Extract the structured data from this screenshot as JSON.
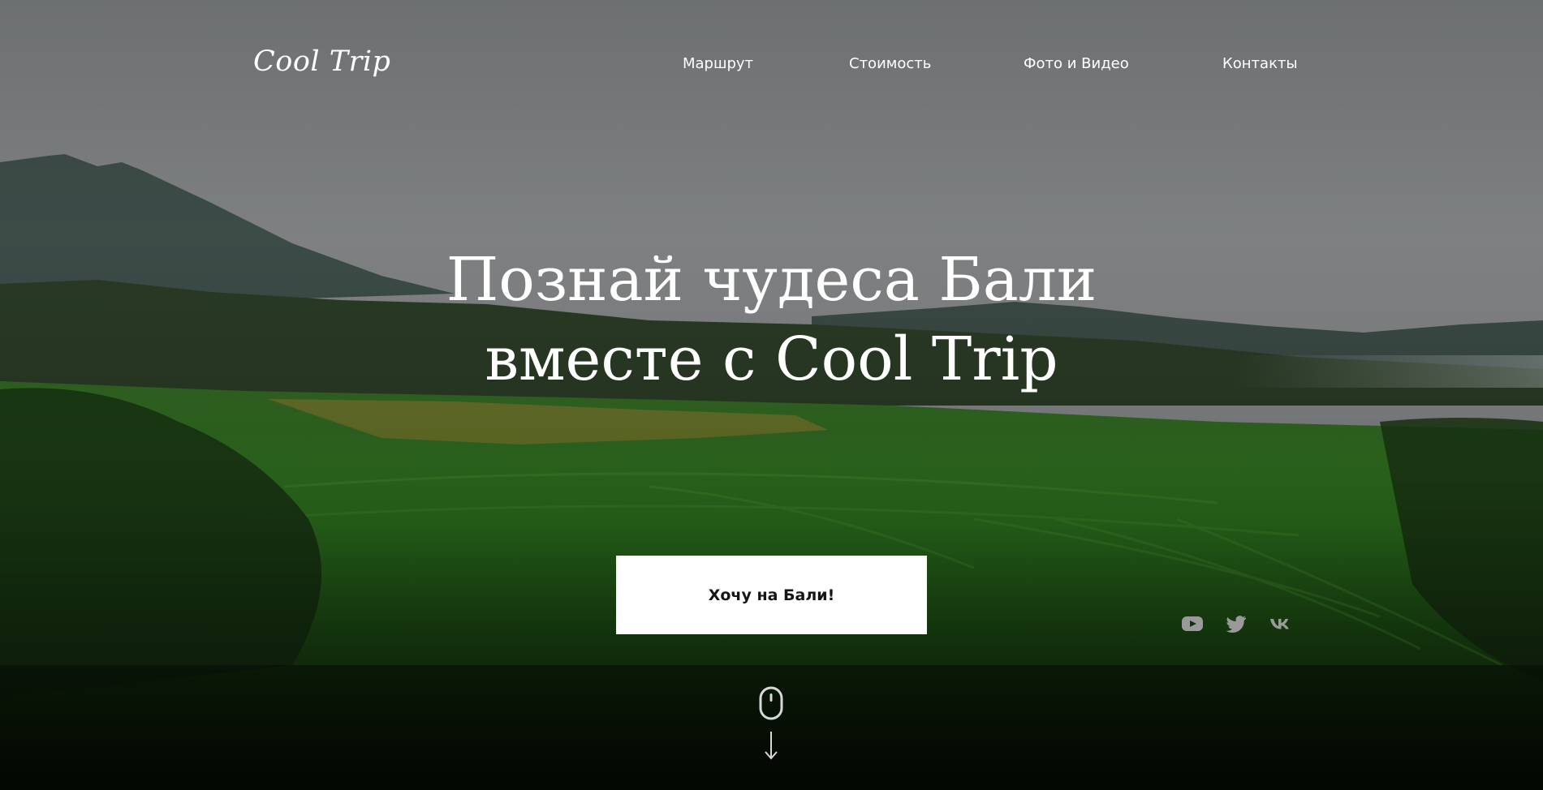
{
  "header": {
    "logo_text": "Cool Trip"
  },
  "nav": {
    "items": [
      {
        "label": "Маршрут"
      },
      {
        "label": "Стоимость"
      },
      {
        "label": "Фото и Видео"
      },
      {
        "label": "Контакты"
      }
    ]
  },
  "hero": {
    "headline_line1": "Познай чудеса Бали",
    "headline_line2": "вместе с Cool Trip",
    "cta_label": "Хочу на Бали!"
  },
  "socials": {
    "icons": [
      "youtube-icon",
      "twitter-icon",
      "vk-icon"
    ]
  },
  "scroll": {
    "icons": [
      "mouse-icon",
      "arrow-down-icon"
    ]
  },
  "colors": {
    "text": "#ffffff",
    "button_bg": "#ffffff",
    "button_text": "#151515",
    "social_icon": "#9a9a9a"
  }
}
